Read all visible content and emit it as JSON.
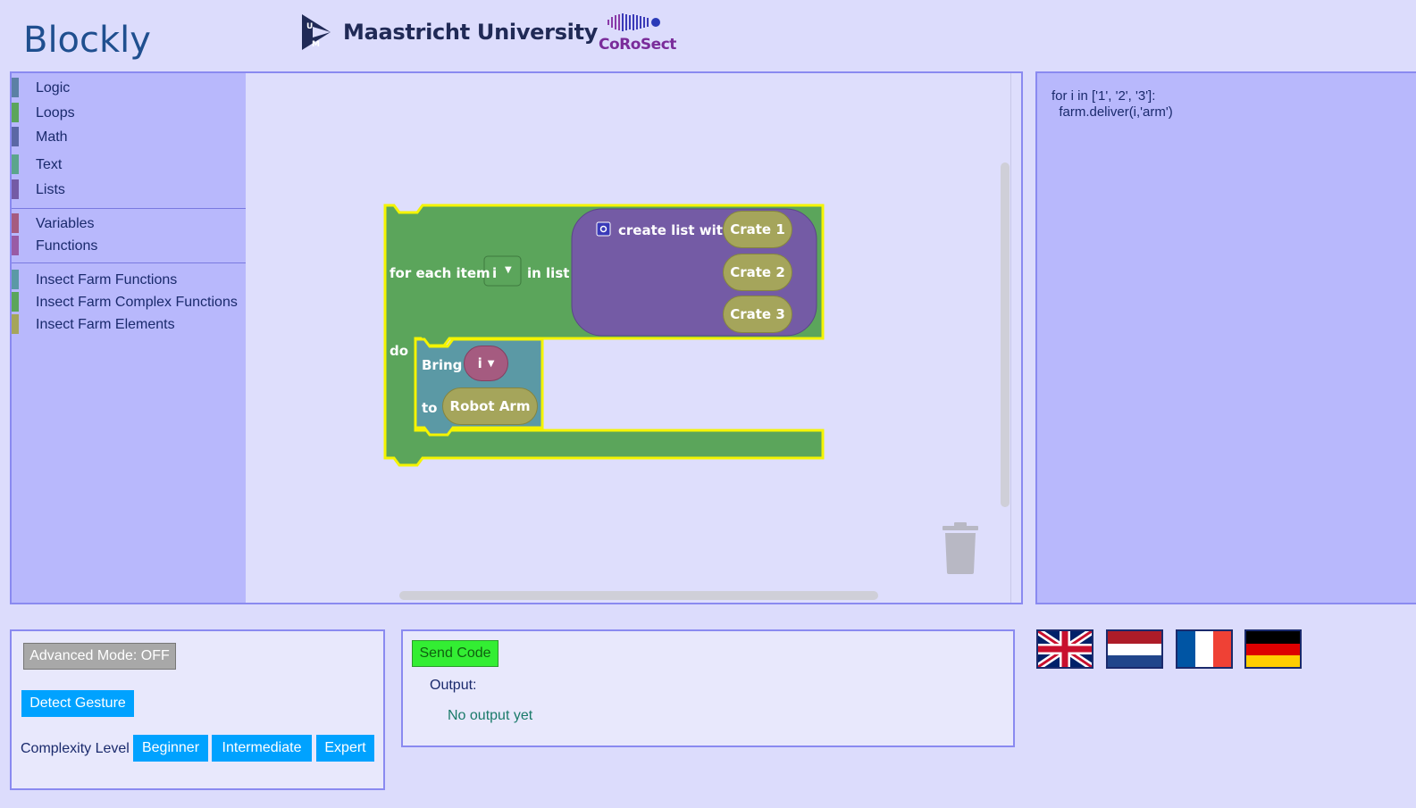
{
  "header": {
    "app_title": "Blockly",
    "university_name": "Maastricht University",
    "partner_name": "CoRoSect"
  },
  "toolbox": {
    "items": [
      {
        "label": "Logic",
        "color": "#5b80a5"
      },
      {
        "label": "Loops",
        "color": "#5ba55b"
      },
      {
        "label": "Math",
        "color": "#5b67a5"
      },
      {
        "label": "Text",
        "color": "#5ba58c"
      },
      {
        "label": "Lists",
        "color": "#745ba5"
      },
      {
        "label": "Variables",
        "color": "#a55b80"
      },
      {
        "label": "Functions",
        "color": "#995ba5"
      },
      {
        "label": "Insect Farm Functions",
        "color": "#5b99a5"
      },
      {
        "label": "Insect Farm Complex Functions",
        "color": "#5ba55b"
      },
      {
        "label": "Insect Farm Elements",
        "color": "#a5a55b"
      }
    ]
  },
  "blocks": {
    "for_each_label": "for each item",
    "loop_var": "i",
    "in_list_label": "in list",
    "do_label": "do",
    "create_list_label": "create list with",
    "list_items": [
      "Crate 1",
      "Crate 2",
      "Crate 3"
    ],
    "bring_label": "Bring",
    "bring_var": "i",
    "to_label": "to",
    "target": "Robot Arm",
    "colors": {
      "loop": "#5ba55b",
      "list": "#745ba5",
      "function": "#5b99a5",
      "element": "#a5a55b",
      "variable": "#a55b80",
      "highlight": "#f4f400"
    }
  },
  "code_panel": {
    "lines": [
      "for i in ['1', '2', '3']:",
      "  farm.deliver(i,'arm')"
    ]
  },
  "controls": {
    "advanced_mode": "Advanced Mode: OFF",
    "detect_gesture": "Detect Gesture",
    "complexity_label": "Complexity Level",
    "levels": [
      "Beginner",
      "Intermediate",
      "Expert"
    ]
  },
  "output": {
    "send_code": "Send Code",
    "output_label": "Output:",
    "output_text": "No output yet"
  },
  "languages": [
    "English",
    "Nederlands",
    "Français",
    "Deutsch"
  ]
}
